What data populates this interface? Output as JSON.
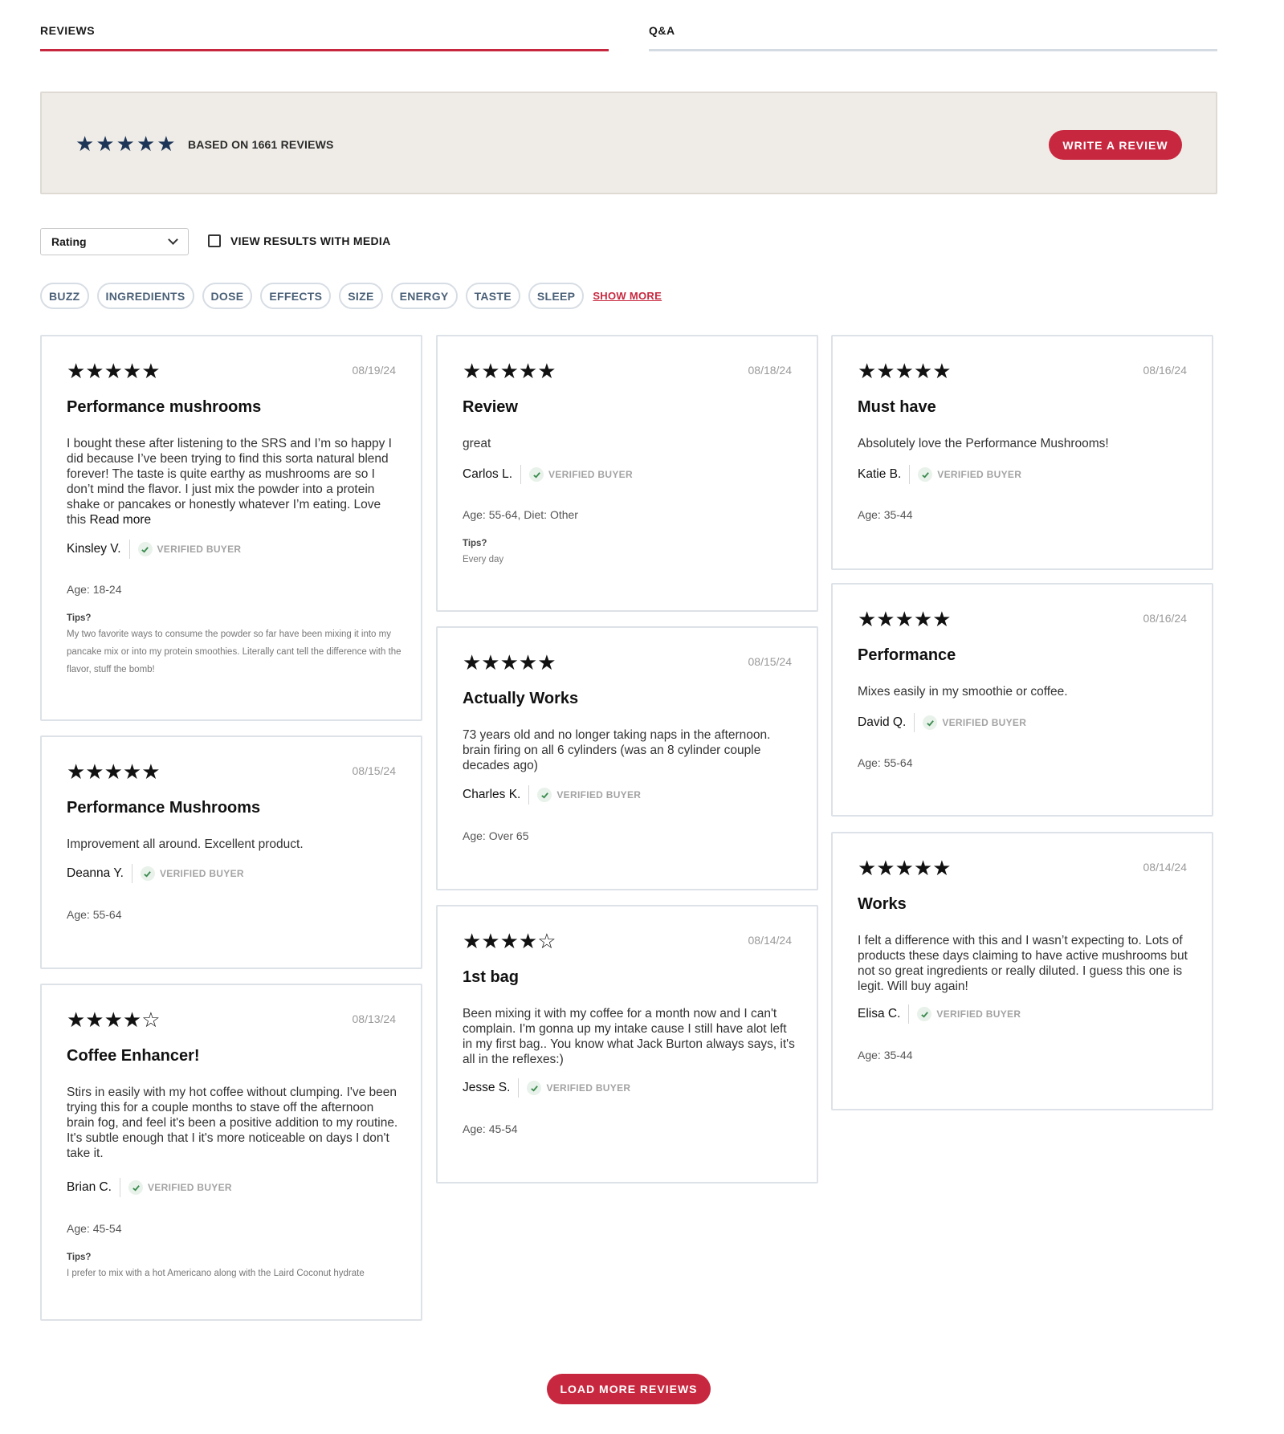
{
  "tabs": {
    "reviews": "REVIEWS",
    "qa": "Q&A"
  },
  "summary": {
    "rating": 5,
    "stars": [
      "★",
      "★",
      "★",
      "★",
      "★"
    ],
    "based_on": "BASED ON 1661 REVIEWS",
    "write_review": "WRITE A REVIEW",
    "star_color": "#1d3557"
  },
  "filters": {
    "rating_select": "Rating",
    "media_label": "VIEW RESULTS WITH MEDIA",
    "chips": [
      "BUZZ",
      "INGREDIENTS",
      "DOSE",
      "EFFECTS",
      "SIZE",
      "ENERGY",
      "TASTE",
      "SLEEP"
    ],
    "show_more": "SHOW MORE"
  },
  "verified_label": "VERIFIED BUYER",
  "tips_label": "Tips?",
  "reviews": {
    "r1": {
      "stars": "★★★★★",
      "rating": 5,
      "date": "08/19/24",
      "title": "Performance mushrooms",
      "body": "I bought these after listening to the SRS and I’m so happy I did because I’ve been trying to find this sorta natural blend forever! The taste is quite earthy as mushrooms are so I don’t mind the flavor. I just mix the powder into a protein shake or pancakes or honestly whatever I’m eating. Love this",
      "read_more": "Read more",
      "author": "Kinsley V.",
      "age": "Age: 18-24",
      "tips": "My two favorite ways to consume the powder so far have been mixing it into my pancake mix or into my protein smoothies. Literally cant tell the difference with the flavor, stuff the bomb!"
    },
    "r2": {
      "stars": "★★★★★",
      "rating": 5,
      "date": "08/15/24",
      "title": "Performance Mushrooms",
      "body": "Improvement all around. Excellent product.",
      "author": "Deanna Y.",
      "age": "Age: 55-64"
    },
    "r3": {
      "stars": "★★★★☆",
      "rating": 4,
      "date": "08/13/24",
      "title": "Coffee Enhancer!",
      "body": "Stirs in easily with my hot coffee without clumping. I've been trying this for a couple months to stave off the afternoon brain fog, and feel it's been a positive addition to my routine. It's subtle enough that I it's more noticeable on days I don't take it.",
      "author": "Brian C.",
      "age": "Age: 45-54",
      "tips": "I prefer to mix with a hot Americano along with the Laird Coconut hydrate"
    },
    "r4": {
      "stars": "★★★★★",
      "rating": 5,
      "date": "08/18/24",
      "title": "Review",
      "body": "great",
      "author": "Carlos L.",
      "age": "Age: 55-64, Diet: Other",
      "tips": "Every day"
    },
    "r5": {
      "stars": "★★★★★",
      "rating": 5,
      "date": "08/15/24",
      "title": "Actually Works",
      "body": "73 years old and no longer taking naps in the afternoon. brain firing on all 6 cylinders (was an 8 cylinder couple decades ago)",
      "author": "Charles K.",
      "age": "Age: Over 65"
    },
    "r6": {
      "stars": "★★★★☆",
      "rating": 4,
      "date": "08/14/24",
      "title": "1st bag",
      "body": "Been mixing it with my coffee for a month now and I can't complain. I'm gonna up my intake cause I still have alot left in my first bag.. You know what Jack Burton always says, it's all in the reflexes:)",
      "author": "Jesse S.",
      "age": "Age: 45-54"
    },
    "r7": {
      "stars": "★★★★★",
      "rating": 5,
      "date": "08/16/24",
      "title": "Must have",
      "body": "Absolutely love the Performance Mushrooms!",
      "author": "Katie B.",
      "age": "Age: 35-44"
    },
    "r8": {
      "stars": "★★★★★",
      "rating": 5,
      "date": "08/16/24",
      "title": "Performance",
      "body": "Mixes easily in my smoothie or coffee.",
      "author": "David Q.",
      "age": "Age: 55-64"
    },
    "r9": {
      "stars": "★★★★★",
      "rating": 5,
      "date": "08/14/24",
      "title": "Works",
      "body": "I felt a difference with this and I wasn’t expecting to. Lots of products these days claiming to have active mushrooms but not so great ingredients or really diluted. I guess this one is legit. Will buy again!",
      "author": "Elisa C.",
      "age": "Age: 35-44"
    }
  },
  "load_more": "LOAD MORE REVIEWS",
  "colors": {
    "accent": "#c8283f",
    "summary_bg": "#efece7",
    "chip_text": "#4b6178"
  }
}
